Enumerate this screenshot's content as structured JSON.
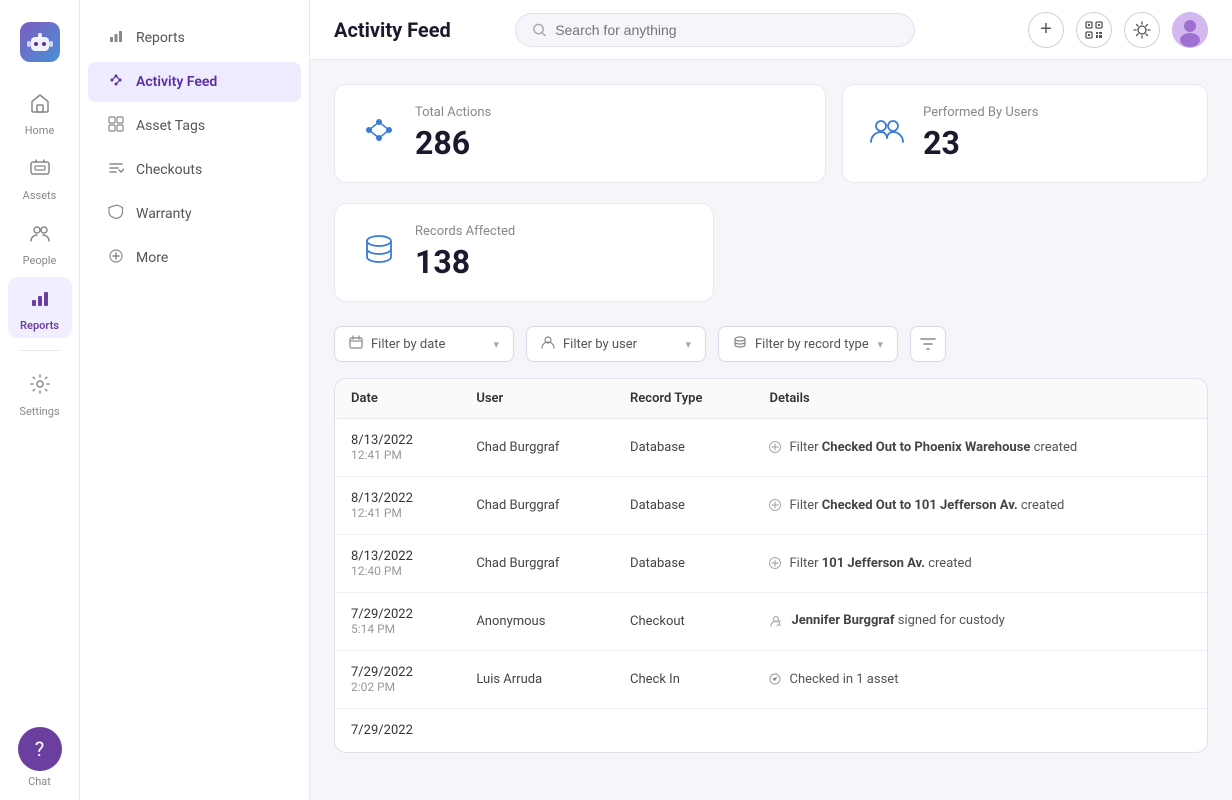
{
  "app": {
    "title": "Activity Feed"
  },
  "topbar": {
    "title": "Activity Feed",
    "search_placeholder": "Search for anything",
    "add_btn": "+",
    "qr_btn": "⊞"
  },
  "icon_nav": {
    "items": [
      {
        "id": "home",
        "label": "Home",
        "icon": "🏠",
        "active": false
      },
      {
        "id": "assets",
        "label": "Assets",
        "icon": "🖥",
        "active": false
      },
      {
        "id": "people",
        "label": "People",
        "icon": "👥",
        "active": false
      },
      {
        "id": "reports",
        "label": "Reports",
        "icon": "📊",
        "active": true
      },
      {
        "id": "settings",
        "label": "Settings",
        "icon": "⚙",
        "active": false
      }
    ],
    "bottom": {
      "id": "chat",
      "label": "Chat",
      "icon": "💬"
    }
  },
  "sidebar": {
    "items": [
      {
        "id": "reports",
        "label": "Reports",
        "icon": "bar-chart",
        "active": false
      },
      {
        "id": "activity-feed",
        "label": "Activity Feed",
        "icon": "activity",
        "active": true
      },
      {
        "id": "asset-tags",
        "label": "Asset Tags",
        "icon": "grid",
        "active": false
      },
      {
        "id": "checkouts",
        "label": "Checkouts",
        "icon": "checkout",
        "active": false
      },
      {
        "id": "warranty",
        "label": "Warranty",
        "icon": "shield",
        "active": false
      },
      {
        "id": "more",
        "label": "More",
        "icon": "plus",
        "active": false
      }
    ]
  },
  "stats": {
    "total_actions": {
      "label": "Total Actions",
      "value": "286"
    },
    "performed_by_users": {
      "label": "Performed By Users",
      "value": "23"
    },
    "records_affected": {
      "label": "Records Affected",
      "value": "138"
    }
  },
  "filters": {
    "date": "Filter by date",
    "user": "Filter by user",
    "record_type": "Filter by record type"
  },
  "table": {
    "headers": [
      "Date",
      "User",
      "Record Type",
      "Details"
    ],
    "rows": [
      {
        "date": "8/13/2022",
        "time": "12:41 PM",
        "user": "Chad Burggraf",
        "record_type": "Database",
        "details_icon": "+",
        "details": "Filter ",
        "details_bold": "Checked Out to Phoenix Warehouse",
        "details_suffix": " created"
      },
      {
        "date": "8/13/2022",
        "time": "12:41 PM",
        "user": "Chad Burggraf",
        "record_type": "Database",
        "details_icon": "+",
        "details": "Filter ",
        "details_bold": "Checked Out to 101 Jefferson Av.",
        "details_suffix": " created"
      },
      {
        "date": "8/13/2022",
        "time": "12:40 PM",
        "user": "Chad Burggraf",
        "record_type": "Database",
        "details_icon": "+",
        "details": "Filter ",
        "details_bold": "101 Jefferson Av.",
        "details_suffix": " created"
      },
      {
        "date": "7/29/2022",
        "time": "5:14 PM",
        "user": "Anonymous",
        "record_type": "Checkout",
        "details_icon": "✍",
        "details": "",
        "details_bold": "Jennifer Burggraf",
        "details_suffix": " signed for custody"
      },
      {
        "date": "7/29/2022",
        "time": "2:02 PM",
        "user": "Luis Arruda",
        "record_type": "Check In",
        "details_icon": "○",
        "details": "",
        "details_bold": "",
        "details_suffix": "Checked in 1 asset"
      },
      {
        "date": "7/29/2022",
        "time": "",
        "user": "",
        "record_type": "",
        "details_icon": "",
        "details": "",
        "details_bold": "",
        "details_suffix": ""
      }
    ]
  }
}
